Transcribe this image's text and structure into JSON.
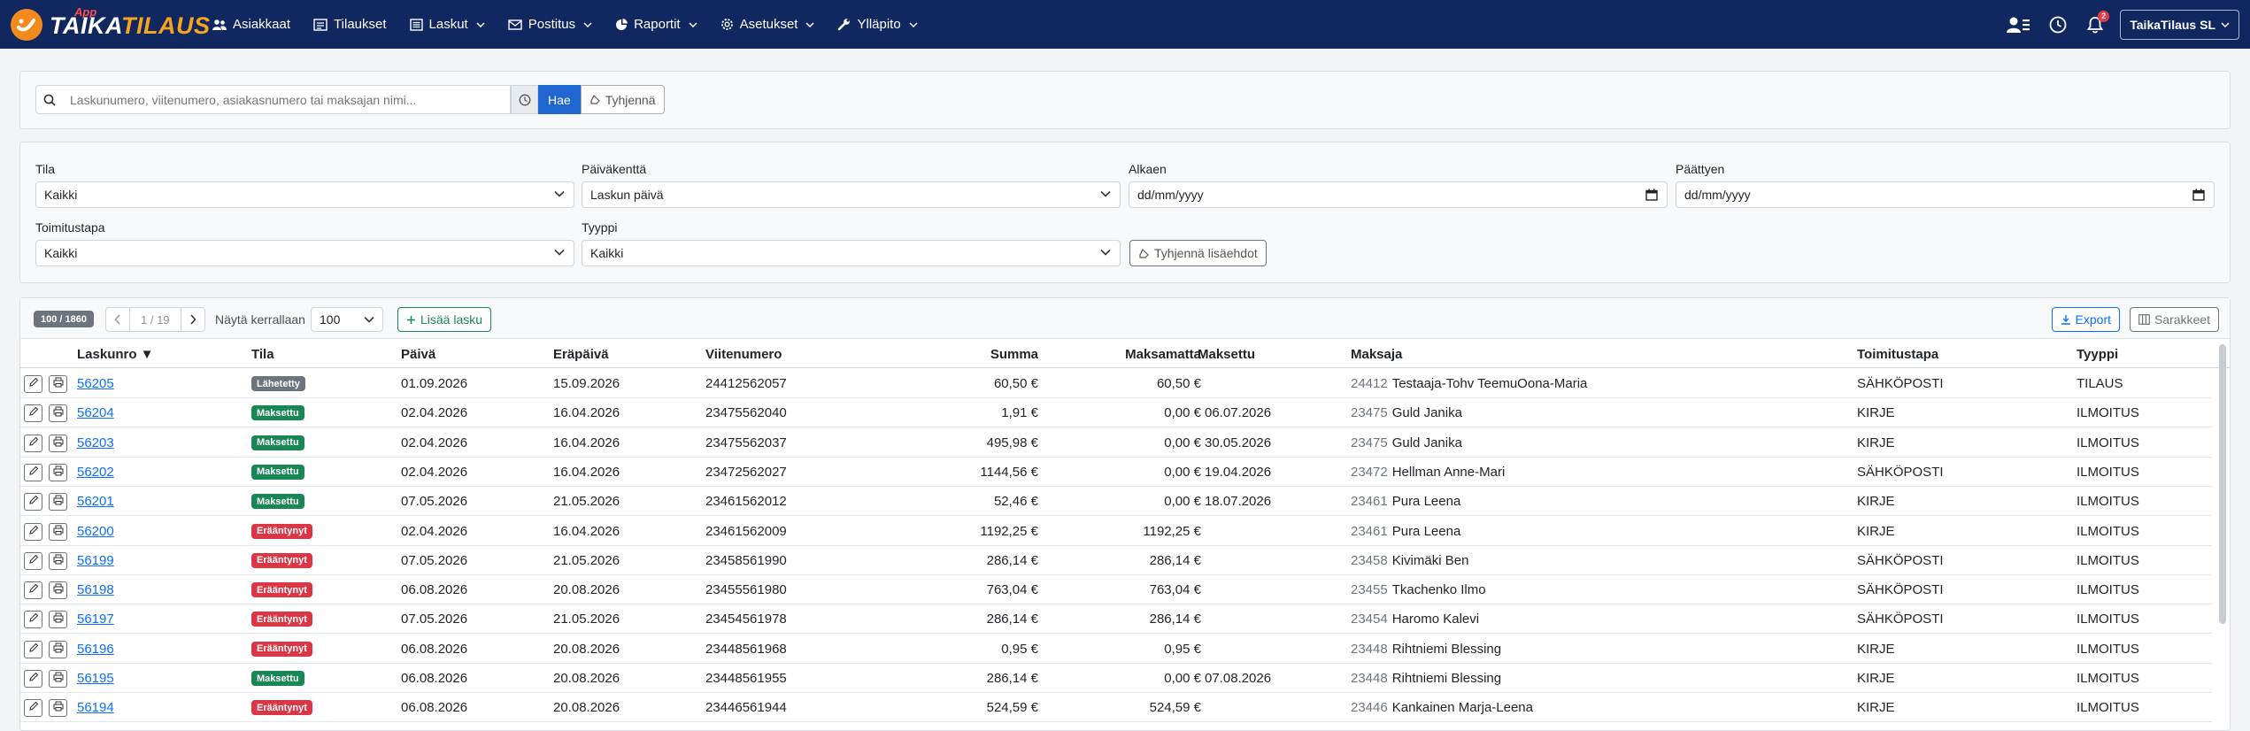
{
  "brand": {
    "app_label": "App",
    "name_part1": "TAIKA",
    "name_part2": "TILAUS"
  },
  "nav": {
    "items": [
      {
        "label": "Asiakkaat",
        "icon": "users-icon",
        "dropdown": false
      },
      {
        "label": "Tilaukset",
        "icon": "orders-icon",
        "dropdown": false
      },
      {
        "label": "Laskut",
        "icon": "invoice-icon",
        "dropdown": true
      },
      {
        "label": "Postitus",
        "icon": "mail-icon",
        "dropdown": true
      },
      {
        "label": "Raportit",
        "icon": "chart-icon",
        "dropdown": true
      },
      {
        "label": "Asetukset",
        "icon": "gear-icon",
        "dropdown": true
      },
      {
        "label": "Ylläpito",
        "icon": "wrench-icon",
        "dropdown": true
      }
    ],
    "notification_count": "2",
    "user_label": "TaikaTilaus SL"
  },
  "search": {
    "placeholder": "Laskunumero, viitenumero, asiakasnumero tai maksajan nimi...",
    "search_button": "Hae",
    "clear_button": "Tyhjennä"
  },
  "filters": {
    "status": {
      "label": "Tila",
      "value": "Kaikki"
    },
    "date_field": {
      "label": "Päiväkenttä",
      "value": "Laskun päivä"
    },
    "start": {
      "label": "Alkaen",
      "placeholder": "dd/mm/yyyy"
    },
    "end": {
      "label": "Päättyen",
      "placeholder": "dd/mm/yyyy"
    },
    "delivery": {
      "label": "Toimitustapa",
      "value": "Kaikki"
    },
    "type": {
      "label": "Tyyppi",
      "value": "Kaikki"
    },
    "clear_extra": "Tyhjennä lisäehdot"
  },
  "toolbar": {
    "count": "100 / 1860",
    "page_info": "1 / 19",
    "per_page_label": "Näytä kerrallaan",
    "per_page_value": "100",
    "add_button": "Lisää lasku",
    "export_button": "Export",
    "columns_button": "Sarakkeet"
  },
  "table": {
    "headers": {
      "number": "Laskunro ▼",
      "status": "Tila",
      "date": "Päivä",
      "due": "Eräpäivä",
      "reference": "Viitenumero",
      "sum": "Summa",
      "unpaid": "Maksamatta",
      "paid": "Maksettu",
      "payer": "Maksaja",
      "delivery": "Toimitustapa",
      "type": "Tyyppi"
    },
    "status_colors": {
      "Lähetetty": "#6c757d",
      "Maksettu": "#198754",
      "Erääntynyt": "#dc3545"
    },
    "rows": [
      {
        "number": "56205",
        "status": "Lähetetty",
        "date": "01.09.2026",
        "due": "15.09.2026",
        "reference": "24412562057",
        "sum": "60,50 €",
        "unpaid": "60,50 €",
        "paid": "",
        "payer_num": "24412",
        "payer_name": "Testaaja-Tohv TeemuOona-Maria",
        "delivery": "SÄHKÖPOSTI",
        "type": "TILAUS"
      },
      {
        "number": "56204",
        "status": "Maksettu",
        "date": "02.04.2026",
        "due": "16.04.2026",
        "reference": "23475562040",
        "sum": "1,91 €",
        "unpaid": "0,00 €",
        "paid": "06.07.2026",
        "payer_num": "23475",
        "payer_name": "Guld Janika",
        "delivery": "KIRJE",
        "type": "ILMOITUS"
      },
      {
        "number": "56203",
        "status": "Maksettu",
        "date": "02.04.2026",
        "due": "16.04.2026",
        "reference": "23475562037",
        "sum": "495,98 €",
        "unpaid": "0,00 €",
        "paid": "30.05.2026",
        "payer_num": "23475",
        "payer_name": "Guld Janika",
        "delivery": "KIRJE",
        "type": "ILMOITUS"
      },
      {
        "number": "56202",
        "status": "Maksettu",
        "date": "02.04.2026",
        "due": "16.04.2026",
        "reference": "23472562027",
        "sum": "1144,56 €",
        "unpaid": "0,00 €",
        "paid": "19.04.2026",
        "payer_num": "23472",
        "payer_name": "Hellman Anne-Mari",
        "delivery": "SÄHKÖPOSTI",
        "type": "ILMOITUS"
      },
      {
        "number": "56201",
        "status": "Maksettu",
        "date": "07.05.2026",
        "due": "21.05.2026",
        "reference": "23461562012",
        "sum": "52,46 €",
        "unpaid": "0,00 €",
        "paid": "18.07.2026",
        "payer_num": "23461",
        "payer_name": "Pura Leena",
        "delivery": "KIRJE",
        "type": "ILMOITUS"
      },
      {
        "number": "56200",
        "status": "Erääntynyt",
        "date": "02.04.2026",
        "due": "16.04.2026",
        "reference": "23461562009",
        "sum": "1192,25 €",
        "unpaid": "1192,25 €",
        "paid": "",
        "payer_num": "23461",
        "payer_name": "Pura Leena",
        "delivery": "KIRJE",
        "type": "ILMOITUS"
      },
      {
        "number": "56199",
        "status": "Erääntynyt",
        "date": "07.05.2026",
        "due": "21.05.2026",
        "reference": "23458561990",
        "sum": "286,14 €",
        "unpaid": "286,14 €",
        "paid": "",
        "payer_num": "23458",
        "payer_name": "Kivimäki Ben",
        "delivery": "SÄHKÖPOSTI",
        "type": "ILMOITUS"
      },
      {
        "number": "56198",
        "status": "Erääntynyt",
        "date": "06.08.2026",
        "due": "20.08.2026",
        "reference": "23455561980",
        "sum": "763,04 €",
        "unpaid": "763,04 €",
        "paid": "",
        "payer_num": "23455",
        "payer_name": "Tkachenko Ilmo",
        "delivery": "SÄHKÖPOSTI",
        "type": "ILMOITUS"
      },
      {
        "number": "56197",
        "status": "Erääntynyt",
        "date": "07.05.2026",
        "due": "21.05.2026",
        "reference": "23454561978",
        "sum": "286,14 €",
        "unpaid": "286,14 €",
        "paid": "",
        "payer_num": "23454",
        "payer_name": "Haromo Kalevi",
        "delivery": "SÄHKÖPOSTI",
        "type": "ILMOITUS"
      },
      {
        "number": "56196",
        "status": "Erääntynyt",
        "date": "06.08.2026",
        "due": "20.08.2026",
        "reference": "23448561968",
        "sum": "0,95 €",
        "unpaid": "0,95 €",
        "paid": "",
        "payer_num": "23448",
        "payer_name": "Rihtniemi Blessing",
        "delivery": "KIRJE",
        "type": "ILMOITUS"
      },
      {
        "number": "56195",
        "status": "Maksettu",
        "date": "06.08.2026",
        "due": "20.08.2026",
        "reference": "23448561955",
        "sum": "286,14 €",
        "unpaid": "0,00 €",
        "paid": "07.08.2026",
        "payer_num": "23448",
        "payer_name": "Rihtniemi Blessing",
        "delivery": "KIRJE",
        "type": "ILMOITUS"
      },
      {
        "number": "56194",
        "status": "Erääntynyt",
        "date": "06.08.2026",
        "due": "20.08.2026",
        "reference": "23446561944",
        "sum": "524,59 €",
        "unpaid": "524,59 €",
        "paid": "",
        "payer_num": "23446",
        "payer_name": "Kankainen Marja-Leena",
        "delivery": "KIRJE",
        "type": "ILMOITUS"
      }
    ]
  }
}
